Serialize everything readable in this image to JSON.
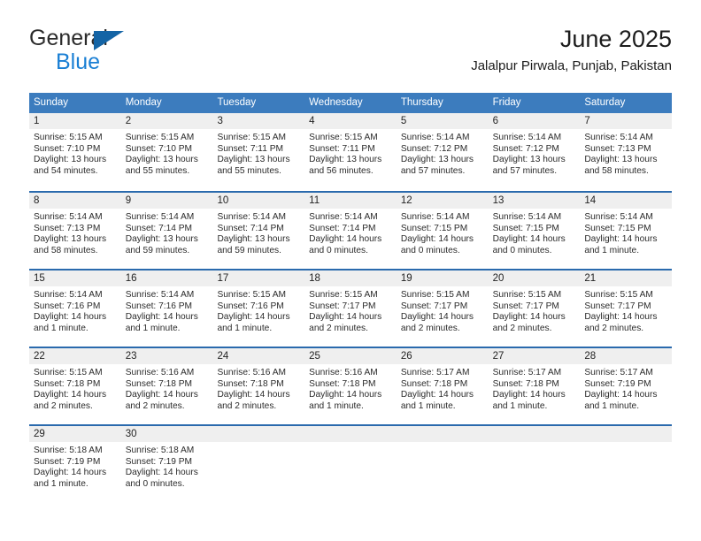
{
  "brand": {
    "word_top": "General",
    "word_bottom": "Blue",
    "flag_icon": "triangle-flag-icon",
    "colors": {
      "top_text": "#2b2b2b",
      "bottom_text": "#1a7fd4",
      "flag": "#1464a5"
    }
  },
  "header": {
    "title": "June 2025",
    "subtitle": "Jalalpur Pirwala, Punjab, Pakistan"
  },
  "colors": {
    "header_blue": "#3c7cbe",
    "row_divider_blue": "#2a6aad",
    "date_band_gray": "#efefef",
    "text": "#2b2b2b"
  },
  "calendar": {
    "weekdays": [
      "Sunday",
      "Monday",
      "Tuesday",
      "Wednesday",
      "Thursday",
      "Friday",
      "Saturday"
    ],
    "weeks": [
      [
        {
          "day": "1",
          "sunrise": "Sunrise: 5:15 AM",
          "sunset": "Sunset: 7:10 PM",
          "daylight": "Daylight: 13 hours and 54 minutes."
        },
        {
          "day": "2",
          "sunrise": "Sunrise: 5:15 AM",
          "sunset": "Sunset: 7:10 PM",
          "daylight": "Daylight: 13 hours and 55 minutes."
        },
        {
          "day": "3",
          "sunrise": "Sunrise: 5:15 AM",
          "sunset": "Sunset: 7:11 PM",
          "daylight": "Daylight: 13 hours and 55 minutes."
        },
        {
          "day": "4",
          "sunrise": "Sunrise: 5:15 AM",
          "sunset": "Sunset: 7:11 PM",
          "daylight": "Daylight: 13 hours and 56 minutes."
        },
        {
          "day": "5",
          "sunrise": "Sunrise: 5:14 AM",
          "sunset": "Sunset: 7:12 PM",
          "daylight": "Daylight: 13 hours and 57 minutes."
        },
        {
          "day": "6",
          "sunrise": "Sunrise: 5:14 AM",
          "sunset": "Sunset: 7:12 PM",
          "daylight": "Daylight: 13 hours and 57 minutes."
        },
        {
          "day": "7",
          "sunrise": "Sunrise: 5:14 AM",
          "sunset": "Sunset: 7:13 PM",
          "daylight": "Daylight: 13 hours and 58 minutes."
        }
      ],
      [
        {
          "day": "8",
          "sunrise": "Sunrise: 5:14 AM",
          "sunset": "Sunset: 7:13 PM",
          "daylight": "Daylight: 13 hours and 58 minutes."
        },
        {
          "day": "9",
          "sunrise": "Sunrise: 5:14 AM",
          "sunset": "Sunset: 7:14 PM",
          "daylight": "Daylight: 13 hours and 59 minutes."
        },
        {
          "day": "10",
          "sunrise": "Sunrise: 5:14 AM",
          "sunset": "Sunset: 7:14 PM",
          "daylight": "Daylight: 13 hours and 59 minutes."
        },
        {
          "day": "11",
          "sunrise": "Sunrise: 5:14 AM",
          "sunset": "Sunset: 7:14 PM",
          "daylight": "Daylight: 14 hours and 0 minutes."
        },
        {
          "day": "12",
          "sunrise": "Sunrise: 5:14 AM",
          "sunset": "Sunset: 7:15 PM",
          "daylight": "Daylight: 14 hours and 0 minutes."
        },
        {
          "day": "13",
          "sunrise": "Sunrise: 5:14 AM",
          "sunset": "Sunset: 7:15 PM",
          "daylight": "Daylight: 14 hours and 0 minutes."
        },
        {
          "day": "14",
          "sunrise": "Sunrise: 5:14 AM",
          "sunset": "Sunset: 7:15 PM",
          "daylight": "Daylight: 14 hours and 1 minute."
        }
      ],
      [
        {
          "day": "15",
          "sunrise": "Sunrise: 5:14 AM",
          "sunset": "Sunset: 7:16 PM",
          "daylight": "Daylight: 14 hours and 1 minute."
        },
        {
          "day": "16",
          "sunrise": "Sunrise: 5:14 AM",
          "sunset": "Sunset: 7:16 PM",
          "daylight": "Daylight: 14 hours and 1 minute."
        },
        {
          "day": "17",
          "sunrise": "Sunrise: 5:15 AM",
          "sunset": "Sunset: 7:16 PM",
          "daylight": "Daylight: 14 hours and 1 minute."
        },
        {
          "day": "18",
          "sunrise": "Sunrise: 5:15 AM",
          "sunset": "Sunset: 7:17 PM",
          "daylight": "Daylight: 14 hours and 2 minutes."
        },
        {
          "day": "19",
          "sunrise": "Sunrise: 5:15 AM",
          "sunset": "Sunset: 7:17 PM",
          "daylight": "Daylight: 14 hours and 2 minutes."
        },
        {
          "day": "20",
          "sunrise": "Sunrise: 5:15 AM",
          "sunset": "Sunset: 7:17 PM",
          "daylight": "Daylight: 14 hours and 2 minutes."
        },
        {
          "day": "21",
          "sunrise": "Sunrise: 5:15 AM",
          "sunset": "Sunset: 7:17 PM",
          "daylight": "Daylight: 14 hours and 2 minutes."
        }
      ],
      [
        {
          "day": "22",
          "sunrise": "Sunrise: 5:15 AM",
          "sunset": "Sunset: 7:18 PM",
          "daylight": "Daylight: 14 hours and 2 minutes."
        },
        {
          "day": "23",
          "sunrise": "Sunrise: 5:16 AM",
          "sunset": "Sunset: 7:18 PM",
          "daylight": "Daylight: 14 hours and 2 minutes."
        },
        {
          "day": "24",
          "sunrise": "Sunrise: 5:16 AM",
          "sunset": "Sunset: 7:18 PM",
          "daylight": "Daylight: 14 hours and 2 minutes."
        },
        {
          "day": "25",
          "sunrise": "Sunrise: 5:16 AM",
          "sunset": "Sunset: 7:18 PM",
          "daylight": "Daylight: 14 hours and 1 minute."
        },
        {
          "day": "26",
          "sunrise": "Sunrise: 5:17 AM",
          "sunset": "Sunset: 7:18 PM",
          "daylight": "Daylight: 14 hours and 1 minute."
        },
        {
          "day": "27",
          "sunrise": "Sunrise: 5:17 AM",
          "sunset": "Sunset: 7:18 PM",
          "daylight": "Daylight: 14 hours and 1 minute."
        },
        {
          "day": "28",
          "sunrise": "Sunrise: 5:17 AM",
          "sunset": "Sunset: 7:19 PM",
          "daylight": "Daylight: 14 hours and 1 minute."
        }
      ],
      [
        {
          "day": "29",
          "sunrise": "Sunrise: 5:18 AM",
          "sunset": "Sunset: 7:19 PM",
          "daylight": "Daylight: 14 hours and 1 minute."
        },
        {
          "day": "30",
          "sunrise": "Sunrise: 5:18 AM",
          "sunset": "Sunset: 7:19 PM",
          "daylight": "Daylight: 14 hours and 0 minutes."
        },
        {
          "day": "",
          "sunrise": "",
          "sunset": "",
          "daylight": ""
        },
        {
          "day": "",
          "sunrise": "",
          "sunset": "",
          "daylight": ""
        },
        {
          "day": "",
          "sunrise": "",
          "sunset": "",
          "daylight": ""
        },
        {
          "day": "",
          "sunrise": "",
          "sunset": "",
          "daylight": ""
        },
        {
          "day": "",
          "sunrise": "",
          "sunset": "",
          "daylight": ""
        }
      ]
    ]
  }
}
